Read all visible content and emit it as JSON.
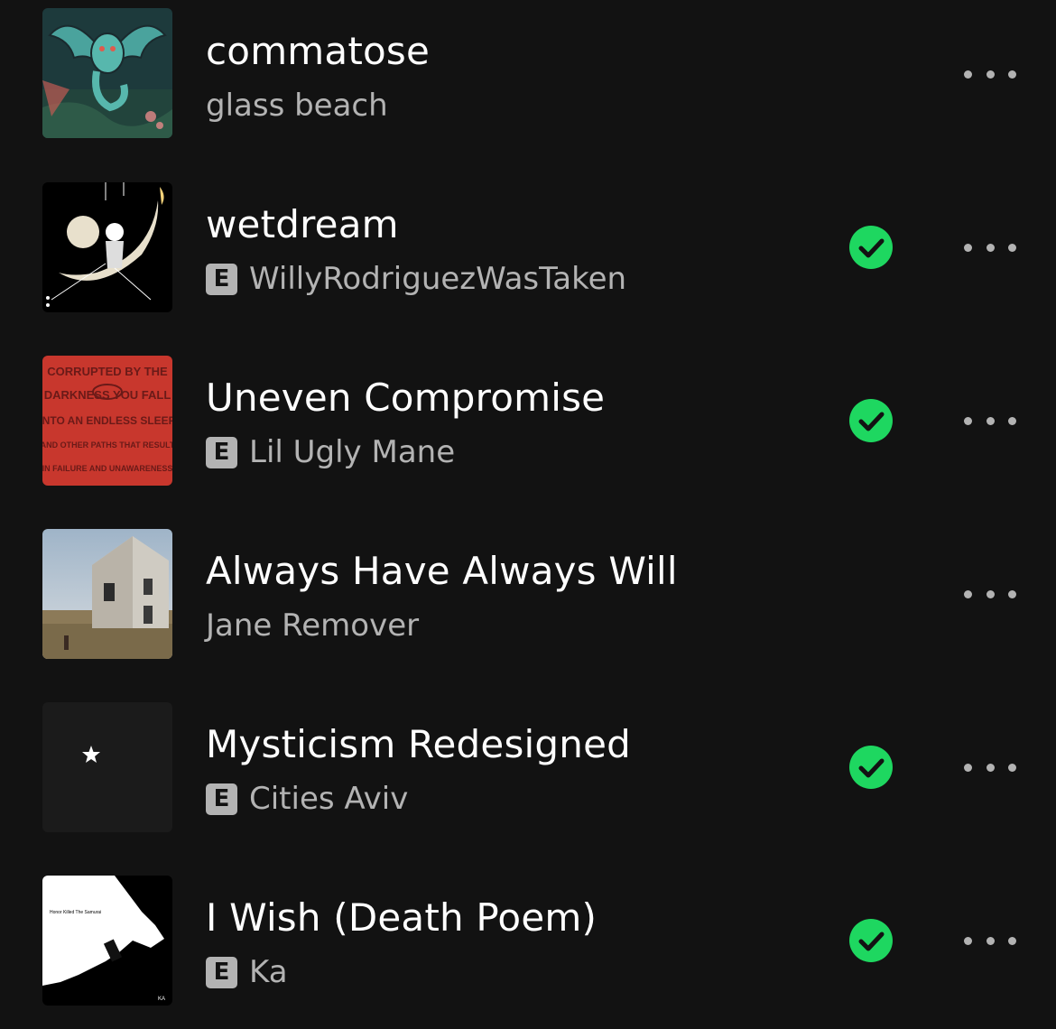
{
  "tracks": [
    {
      "title": "commatose",
      "artist": "glass beach",
      "explicit": false,
      "downloaded": false,
      "art_icon": "album-art-commatose"
    },
    {
      "title": "wetdream",
      "artist": "WillyRodriguezWasTaken",
      "explicit": true,
      "downloaded": true,
      "art_icon": "album-art-wetdream"
    },
    {
      "title": "Uneven Compromise",
      "artist": "Lil Ugly Mane",
      "explicit": true,
      "downloaded": true,
      "art_icon": "album-art-uneven-compromise",
      "art_text": [
        "CORRUPTED BY THE",
        "DARKNESS YOU FALL",
        "INTO AN ENDLESS SLEEP",
        "AND OTHER PATHS THAT RESULT",
        "IN FAILURE AND UNAWARENESS"
      ]
    },
    {
      "title": "Always Have Always Will",
      "artist": "Jane Remover",
      "explicit": false,
      "downloaded": false,
      "art_icon": "album-art-always-have-always-will"
    },
    {
      "title": "Mysticism Redesigned",
      "artist": "Cities Aviv",
      "explicit": true,
      "downloaded": true,
      "art_icon": "album-art-mysticism-redesigned"
    },
    {
      "title": "I Wish (Death Poem)",
      "artist": "Ka",
      "explicit": true,
      "downloaded": true,
      "art_icon": "album-art-honor-killed-the-samurai",
      "art_text": [
        "Honor Killed The Samurai",
        "KA"
      ]
    }
  ],
  "explicit_label": "E",
  "colors": {
    "background": "#121212",
    "title": "#ffffff",
    "secondary": "#b3b3b3",
    "downloaded_green": "#1ed760"
  },
  "icons": {
    "downloaded": "check-circle-icon",
    "more": "more-options-icon"
  }
}
